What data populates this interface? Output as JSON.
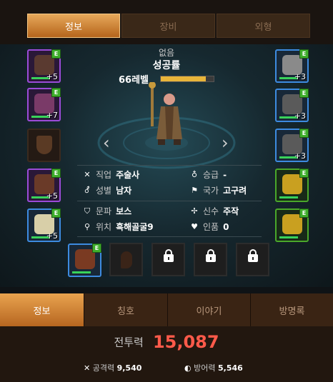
{
  "top_tabs": [
    "정보",
    "장비",
    "외형"
  ],
  "character": {
    "title": "없음",
    "name": "성공률",
    "level": "66레벨",
    "exp_fraction": 0.85
  },
  "info": {
    "job_label": "직업",
    "job_value": "주술사",
    "rank_label": "승급",
    "rank_value": "-",
    "gender_label": "성별",
    "gender_value": "남자",
    "nation_label": "국가",
    "nation_value": "고구려",
    "faction_label": "문파",
    "faction_value": "보스",
    "deity_label": "신수",
    "deity_value": "주작",
    "location_label": "위치",
    "location_value": "흑해골굴9",
    "honor_label": "인품",
    "honor_value": "0"
  },
  "left_slots": [
    {
      "plus": "+5"
    },
    {
      "plus": "+7"
    },
    {
      "plus": ""
    },
    {
      "plus": "+5"
    },
    {
      "plus": "+5"
    }
  ],
  "right_slots": [
    {
      "plus": "+3"
    },
    {
      "plus": "+3"
    },
    {
      "plus": "+3"
    },
    {
      "plus": ""
    },
    {
      "plus": ""
    }
  ],
  "badge": "E",
  "bottom_tabs": [
    "정보",
    "칭호",
    "이야기",
    "방명록"
  ],
  "stats": {
    "power_label": "전투력",
    "power_value": "15,087",
    "attack_label": "공격력",
    "attack_value": "9,540",
    "defense_label": "방어력",
    "defense_value": "5,546"
  },
  "colors": {
    "accent": "#e8a455",
    "power": "#ff5a4a"
  }
}
